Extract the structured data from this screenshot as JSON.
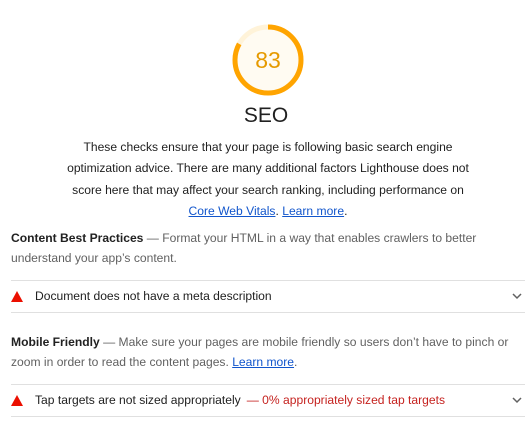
{
  "score": {
    "value": "83",
    "fraction": 0.83,
    "color": "#ffa400"
  },
  "category": {
    "title": "SEO",
    "intro_text": "These checks ensure that your page is following basic search engine optimization advice. There are many additional factors Lighthouse does not score here that may affect your search ranking, including performance on",
    "cwv_link": "Core Web Vitals",
    "sep": ".",
    "learn_more": "Learn more",
    "end": "."
  },
  "groups": [
    {
      "name": "Content Best Practices",
      "desc": " — Format your HTML in a way that enables crawlers to better understand your app’s content.",
      "audits": [
        {
          "title": "Document does not have a meta description",
          "display": ""
        }
      ]
    },
    {
      "name": "Mobile Friendly",
      "desc": " — Make sure your pages are mobile friendly so users don’t have to pinch or zoom in order to read the content pages. ",
      "learn_more": "Learn more",
      "end": ".",
      "audits": [
        {
          "title": "Tap targets are not sized appropriately",
          "display": "— 0% appropriately sized tap targets"
        }
      ]
    }
  ],
  "icons": {
    "fail": "warning-triangle-icon",
    "expand": "chevron-down-icon"
  },
  "colors": {
    "fail": "#eb0f00",
    "score": "#ffa400",
    "link": "#1155cc",
    "display": "#c5221f"
  }
}
